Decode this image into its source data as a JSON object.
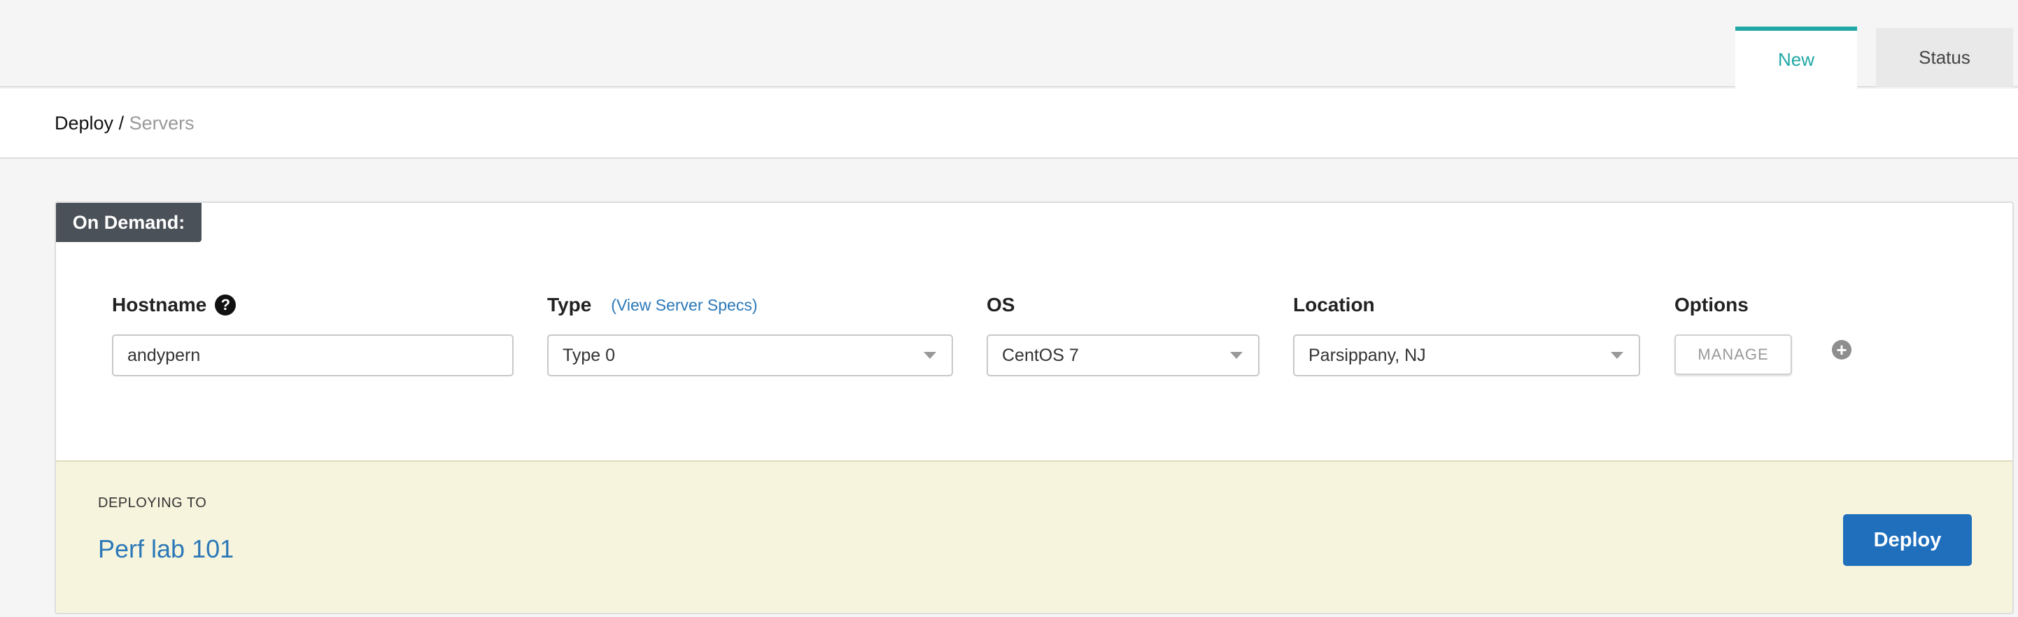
{
  "tabs": [
    {
      "label": "New",
      "active": true
    },
    {
      "label": "Status",
      "active": false
    }
  ],
  "breadcrumb": {
    "root": "Deploy",
    "separator": "/",
    "current": "Servers"
  },
  "section": {
    "title": "On Demand:"
  },
  "fields": {
    "hostname": {
      "label": "Hostname",
      "help_icon": "?",
      "value": "andypern"
    },
    "type": {
      "label": "Type",
      "link": "(View Server Specs)",
      "value": "Type 0"
    },
    "os": {
      "label": "OS",
      "value": "CentOS 7"
    },
    "location": {
      "label": "Location",
      "value": "Parsippany, NJ"
    },
    "options": {
      "label": "Options",
      "manage_label": "MANAGE",
      "add_icon": "+"
    }
  },
  "deploy": {
    "heading": "DEPLOYING TO",
    "target": "Perf lab 101",
    "button_label": "Deploy"
  },
  "colors": {
    "accent": "#1fa8a4",
    "link": "#2b78b8",
    "primary_button": "#1f6fbd",
    "deploy_panel_bg": "#f7f4dd",
    "section_tag_bg": "#4b5158"
  }
}
